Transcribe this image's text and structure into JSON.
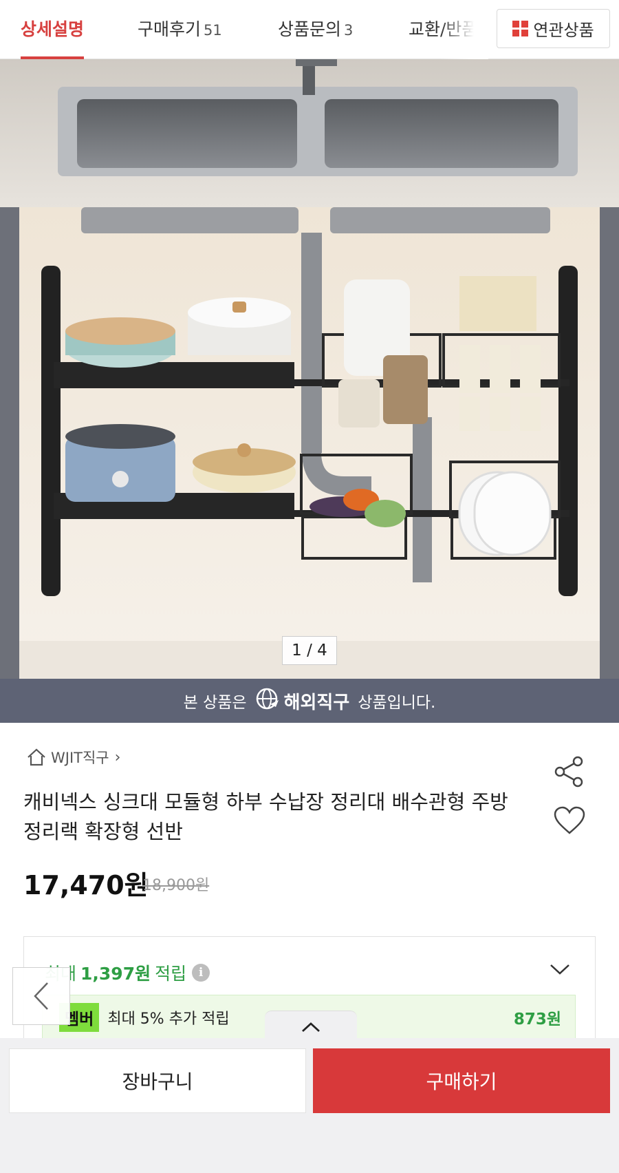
{
  "tabs": [
    {
      "label": "상세설명",
      "count": ""
    },
    {
      "label": "구매후기",
      "count": "51"
    },
    {
      "label": "상품문의",
      "count": "3"
    },
    {
      "label": "교환/반품",
      "count": ""
    }
  ],
  "related_label": "연관상품",
  "image_counter": "1 / 4",
  "overseas": {
    "prefix": "본 상품은",
    "highlight": "해외직구",
    "suffix": "상품입니다."
  },
  "product": {
    "store": "WJIT직구",
    "title": "캐비넥스 싱크대 모듈형 하부 수납장 정리대 배수관형 주방 정리랙 확장형 선반",
    "price": "17,470원",
    "original_price": "18,900원"
  },
  "reward": {
    "prefix": "최대",
    "amount": "1,397원",
    "suffix": "적립",
    "member_badge": "멤버",
    "member_text": "최대 5% 추가 적립",
    "member_amount": "873원"
  },
  "actions": {
    "cart": "장바구니",
    "buy": "구매하기"
  },
  "colors": {
    "accent": "#d8393a",
    "reward_green": "#2e9e44",
    "banner": "#5e6375"
  }
}
